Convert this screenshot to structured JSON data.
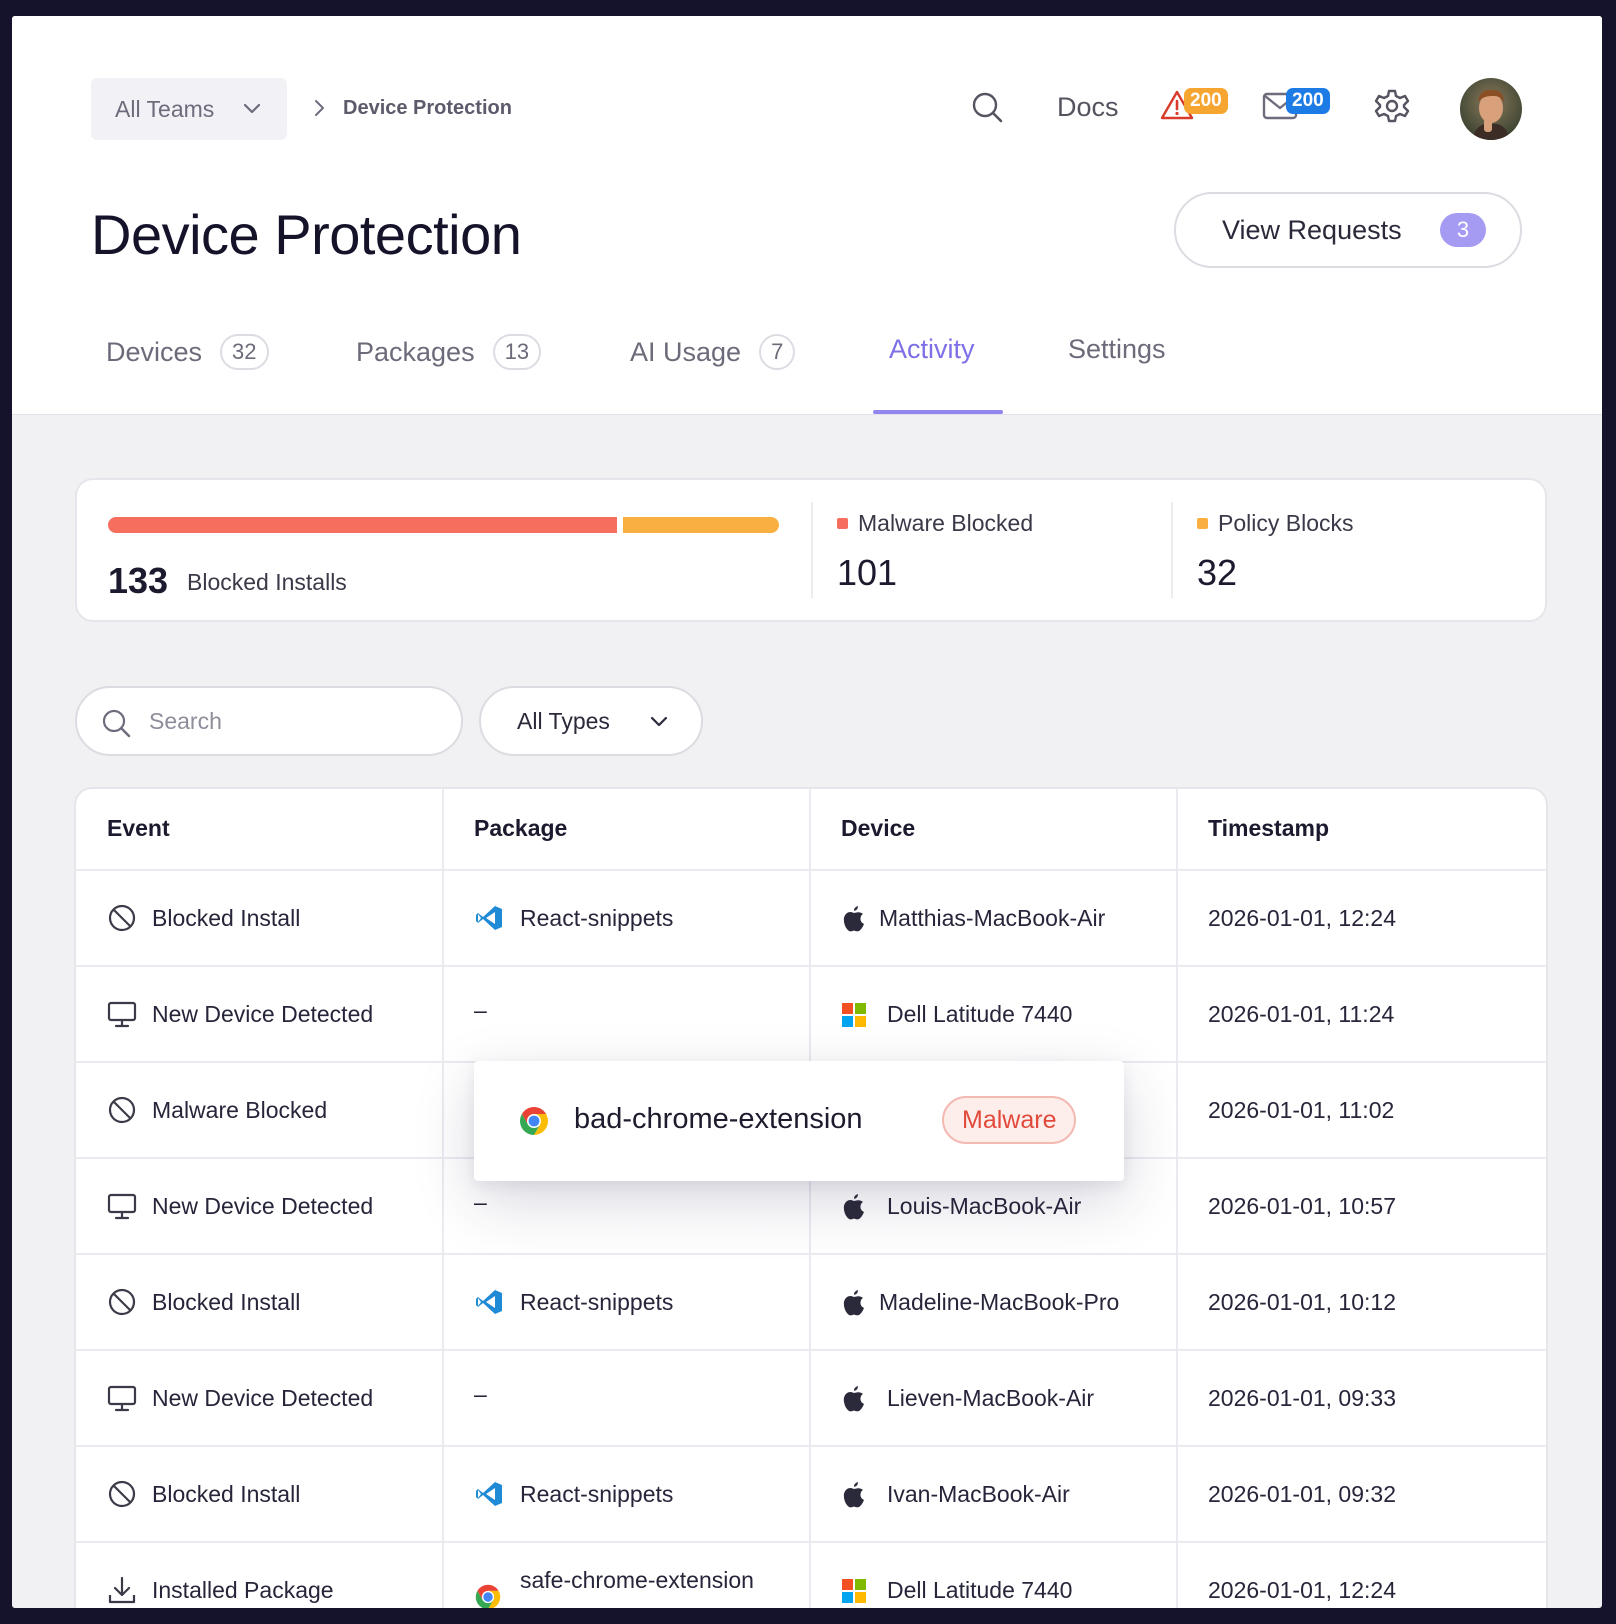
{
  "header": {
    "team_select": "All Teams",
    "breadcrumb_current": "Device Protection",
    "docs_label": "Docs",
    "alerts_count": "200",
    "messages_count": "200"
  },
  "page": {
    "title": "Device Protection",
    "view_requests_label": "View Requests",
    "view_requests_count": "3"
  },
  "tabs": [
    {
      "label": "Devices",
      "count": "32"
    },
    {
      "label": "Packages",
      "count": "13"
    },
    {
      "label": "AI Usage",
      "count": "7"
    },
    {
      "label": "Activity",
      "count": null,
      "active": true
    },
    {
      "label": "Settings",
      "count": null
    }
  ],
  "stats": {
    "total": "133",
    "total_label": "Blocked Installs",
    "malware_label": "Malware Blocked",
    "malware_value": "101",
    "policy_label": "Policy Blocks",
    "policy_value": "32",
    "malware_color": "#f56e5e",
    "policy_color": "#f9b040"
  },
  "filters": {
    "search_placeholder": "Search",
    "type_select": "All Types"
  },
  "table": {
    "headers": [
      "Event",
      "Package",
      "Device",
      "Timestamp"
    ],
    "rows": [
      {
        "event_icon": "blocked-icon",
        "event": "Blocked Install",
        "package_icon": "vscode-icon",
        "package": "React-snippets",
        "device_icon": "apple-icon",
        "device": "Matthias-MacBook-Air",
        "timestamp": "2026-01-01, 12:24"
      },
      {
        "event_icon": "monitor-icon",
        "event": "New Device Detected",
        "package_icon": null,
        "package": "–",
        "device_icon": "windows-icon",
        "device": "Dell Latitude 7440",
        "timestamp": "2026-01-01, 11:24"
      },
      {
        "event_icon": "blocked-icon",
        "event": "Malware Blocked",
        "package_icon": null,
        "package": "",
        "device_icon": null,
        "device": "",
        "timestamp": "2026-01-01, 11:02"
      },
      {
        "event_icon": "monitor-icon",
        "event": "New Device Detected",
        "package_icon": null,
        "package": "–",
        "device_icon": "apple-icon",
        "device": "Louis-MacBook-Air",
        "timestamp": "2026-01-01, 10:57"
      },
      {
        "event_icon": "blocked-icon",
        "event": "Blocked Install",
        "package_icon": "vscode-icon",
        "package": "React-snippets",
        "device_icon": "apple-icon",
        "device": "Madeline-MacBook-Pro",
        "timestamp": "2026-01-01, 10:12"
      },
      {
        "event_icon": "monitor-icon",
        "event": "New Device Detected",
        "package_icon": null,
        "package": "–",
        "device_icon": "apple-icon",
        "device": "Lieven-MacBook-Air",
        "timestamp": "2026-01-01, 09:33"
      },
      {
        "event_icon": "blocked-icon",
        "event": "Blocked Install",
        "package_icon": "vscode-icon",
        "package": "React-snippets",
        "device_icon": "apple-icon",
        "device": "Ivan-MacBook-Air",
        "timestamp": "2026-01-01, 09:32"
      },
      {
        "event_icon": "download-icon",
        "event": "Installed Package",
        "package_icon": "chrome-icon",
        "package": "safe-chrome-extension",
        "device_icon": "windows-icon",
        "device": "Dell Latitude 7440",
        "timestamp": "2026-01-01, 12:24"
      }
    ]
  },
  "popover": {
    "package_icon": "chrome-icon",
    "package": "bad-chrome-extension",
    "tag": "Malware"
  }
}
